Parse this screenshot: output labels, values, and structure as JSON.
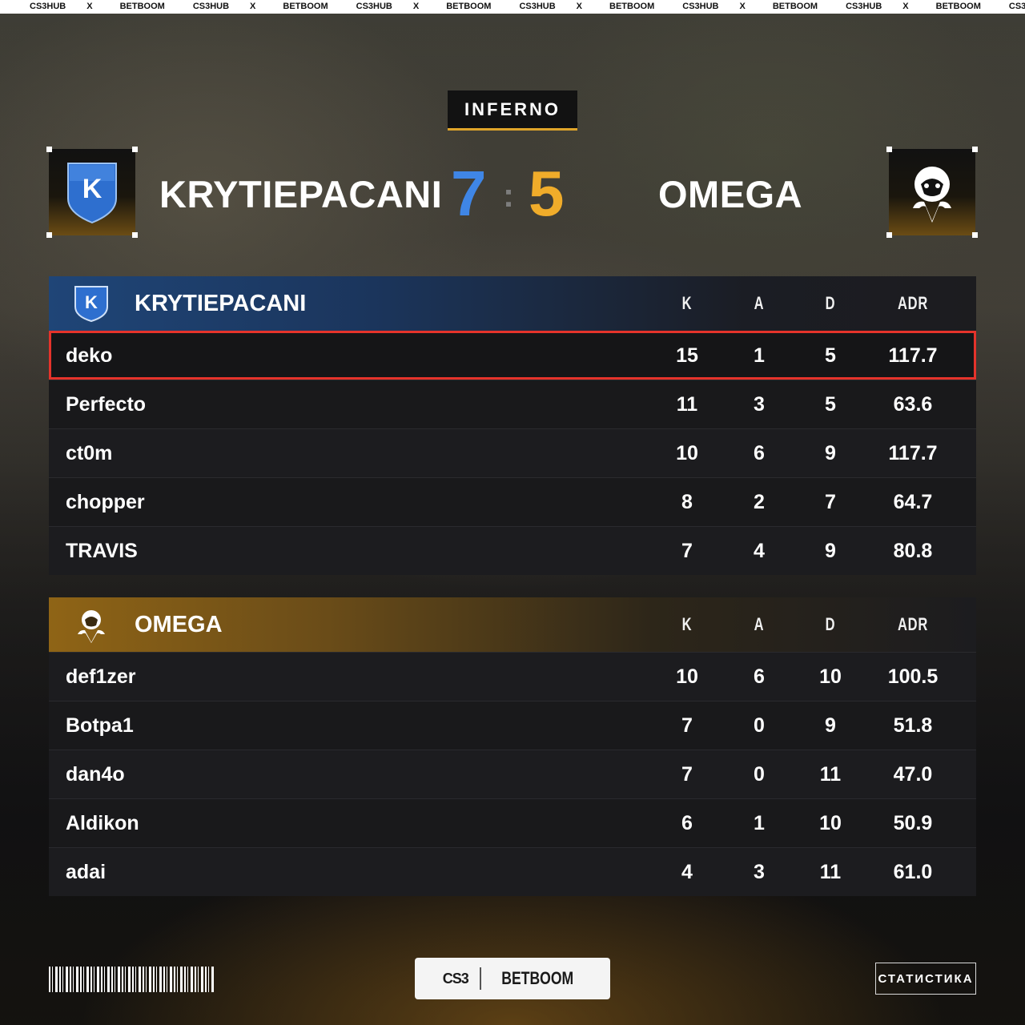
{
  "ticker": [
    "CS3HUB",
    "X",
    "BETBOOM"
  ],
  "map": "INFERNO",
  "match": {
    "team1": "KRYTIEPACANI",
    "team2": "OMEGA",
    "score1": "7",
    "separator": ":",
    "score2": "5"
  },
  "colors": {
    "team1_accent": "#3f86e6",
    "team2_accent": "#f0ac2a",
    "highlight": "#e5332b"
  },
  "icons": {
    "team1_logo": "shield-k-icon",
    "team2_logo": "omega-mask-icon"
  },
  "tables": [
    {
      "team": "KRYTIEPACANI",
      "headers": [
        "K",
        "A",
        "D",
        "ADR"
      ],
      "players": [
        {
          "name": "deko",
          "k": "15",
          "a": "1",
          "d": "5",
          "adr": "117.7",
          "highlighted": true
        },
        {
          "name": "Perfecto",
          "k": "11",
          "a": "3",
          "d": "5",
          "adr": "63.6"
        },
        {
          "name": "ct0m",
          "k": "10",
          "a": "6",
          "d": "9",
          "adr": "117.7"
        },
        {
          "name": "chopper",
          "k": "8",
          "a": "2",
          "d": "7",
          "adr": "64.7"
        },
        {
          "name": "TRAVIS",
          "k": "7",
          "a": "4",
          "d": "9",
          "adr": "80.8"
        }
      ]
    },
    {
      "team": "OMEGA",
      "headers": [
        "K",
        "A",
        "D",
        "ADR"
      ],
      "players": [
        {
          "name": "def1zer",
          "k": "10",
          "a": "6",
          "d": "10",
          "adr": "100.5"
        },
        {
          "name": "Botpa1",
          "k": "7",
          "a": "0",
          "d": "9",
          "adr": "51.8"
        },
        {
          "name": "dan4o",
          "k": "7",
          "a": "0",
          "d": "11",
          "adr": "47.0"
        },
        {
          "name": "Aldikon",
          "k": "6",
          "a": "1",
          "d": "10",
          "adr": "50.9"
        },
        {
          "name": "adai",
          "k": "4",
          "a": "3",
          "d": "11",
          "adr": "61.0"
        }
      ]
    }
  ],
  "footer": {
    "sponsor_left": "CS3",
    "sponsor_right": "BETBOOM",
    "stats_button": "СТАТИСТИКА"
  }
}
